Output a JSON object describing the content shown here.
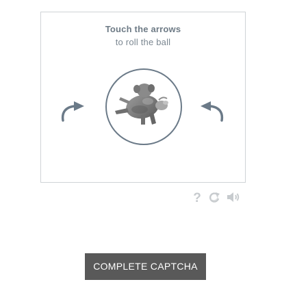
{
  "captcha": {
    "instruction_title": "Touch the arrows",
    "instruction_subtitle": "to roll the ball",
    "ball_image": "rolling-animal-figure",
    "controls": {
      "left_arrow": "curved-arrow-left-icon",
      "right_arrow": "curved-arrow-right-icon"
    },
    "tools": {
      "help_symbol": "?",
      "help_icon": "help-icon",
      "refresh_icon": "refresh-icon",
      "audio_icon": "audio-icon"
    },
    "colors": {
      "arrow": "#6b7a88",
      "circle_border": "#6b7a88",
      "panel_border": "#cfd3d6",
      "tool_icons": "#c7cbce"
    }
  },
  "submit": {
    "label": "COMPLETE CAPTCHA",
    "background": "#595959"
  }
}
